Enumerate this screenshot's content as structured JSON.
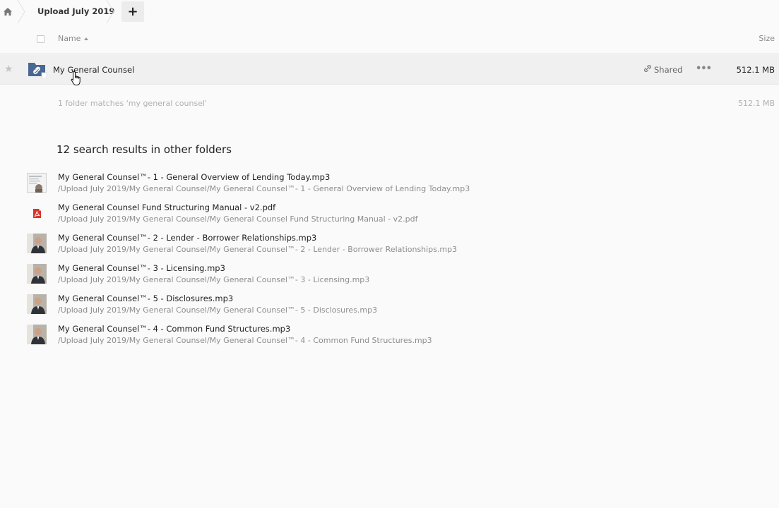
{
  "breadcrumb": {
    "home_icon": "home-icon",
    "current": "Upload July 2019",
    "add_label": "+"
  },
  "header": {
    "name_label": "Name",
    "size_label": "Size",
    "sort_icon": "sort-ascending-icon"
  },
  "folder": {
    "name": "My General Counsel",
    "shared_label": "Shared",
    "more_label": "•••",
    "size": "512.1 MB",
    "icon": "shared-link-folder-icon",
    "accent": "#4a6793"
  },
  "summary": {
    "text": "1 folder matches 'my general counsel'",
    "size": "512.1 MB"
  },
  "section_title": "12 search results in other folders",
  "results": [
    {
      "name": "My General Counsel™- 1 - General Overview of Lending Today.mp3",
      "path": "/Upload July 2019/My General Counsel/My General Counsel™- 1 - General Overview of Lending Today.mp3",
      "thumb": "document-thumbnail"
    },
    {
      "name": "My General Counsel Fund Structuring Manual - v2.pdf",
      "path": "/Upload July 2019/My General Counsel/My General Counsel Fund Structuring Manual - v2.pdf",
      "thumb": "pdf-icon"
    },
    {
      "name": "My General Counsel™- 2 - Lender - Borrower Relationships.mp3",
      "path": "/Upload July 2019/My General Counsel/My General Counsel™- 2 - Lender - Borrower Relationships.mp3",
      "thumb": "person-thumbnail"
    },
    {
      "name": "My General Counsel™- 3 - Licensing.mp3",
      "path": "/Upload July 2019/My General Counsel/My General Counsel™- 3 - Licensing.mp3",
      "thumb": "person-thumbnail"
    },
    {
      "name": "My General Counsel™- 5 - Disclosures.mp3",
      "path": "/Upload July 2019/My General Counsel/My General Counsel™- 5 - Disclosures.mp3",
      "thumb": "person-thumbnail"
    },
    {
      "name": "My General Counsel™- 4 - Common Fund Structures.mp3",
      "path": "/Upload July 2019/My General Counsel/My General Counsel™- 4 - Common Fund Structures.mp3",
      "thumb": "person-thumbnail"
    }
  ]
}
